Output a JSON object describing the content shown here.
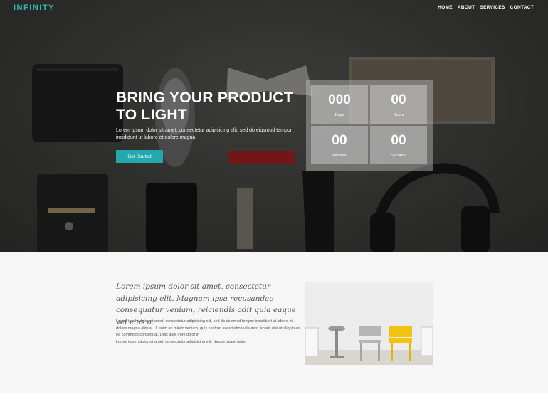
{
  "brand": {
    "name": "INFINITY"
  },
  "nav": {
    "items": [
      "HOME",
      "ABOUT",
      "SERVICES",
      "CONTACT"
    ]
  },
  "hero": {
    "headline_line1": "BRING YOUR PRODUCT",
    "headline_line2": "TO LIGHT",
    "text": "Lorem ipsum dolor sit amet, consectetur adipisicing elit, sed do eiusmod tempor incididunt ut labore et dolore magna",
    "cta_label": "Get Started"
  },
  "countdown": {
    "days": {
      "value": "000",
      "label": "Days"
    },
    "hours": {
      "value": "00",
      "label": "Hours"
    },
    "minutes": {
      "value": "00",
      "label": "Minutes"
    },
    "seconds": {
      "value": "00",
      "label": "Seconds"
    }
  },
  "about": {
    "quote": "Lorem ipsum dolor sit amet, consectetur adipisicing elit. Magnam ipsa recusandae consequatur veniam, reiciendis odit quia eaque vel eius a.",
    "paragraph1": "Lorem ipsum dolor sit amet, consectetur adipisicing elit, sed do eiusmod tempor incididunt ut labore et dolore magna aliqua. Ut enim ad minim veniam, quis nostrud exercitation ulla-mco laboris nisi ut aliquip ex ea commodo consequat. Duis aute irure dolor in",
    "paragraph2": "Lorem ipsum dolor sit amet, consectetur adipisicing elit. Neque, aspernatur."
  },
  "colors": {
    "accent": "#24a8ae",
    "brand": "#36b7bd",
    "hero_bg": "#383836",
    "section_bg": "#f6f6f6",
    "chair_highlight": "#f1c40f"
  }
}
